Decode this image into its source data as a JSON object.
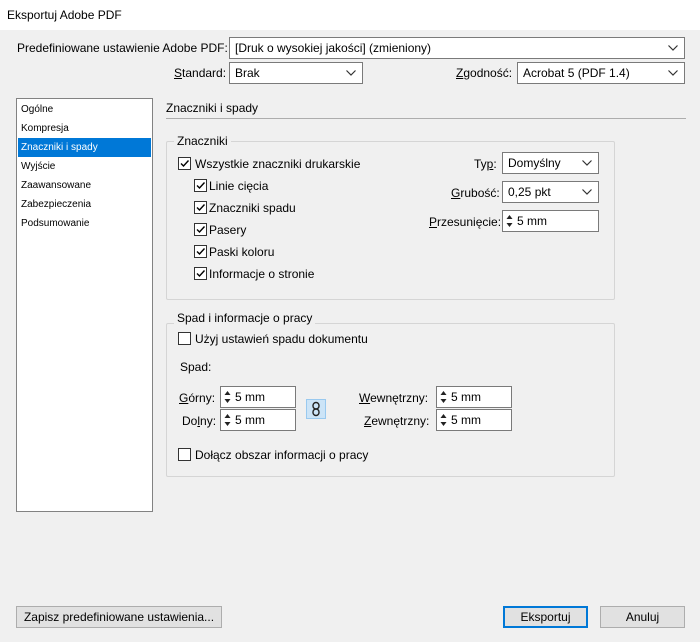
{
  "window": {
    "title": "Eksportuj Adobe PDF"
  },
  "top": {
    "preset_label": "Predefiniowane ustawienie Adobe PDF:",
    "preset_value": "[Druk o wysokiej jakości] (zmieniony)",
    "standard_label": "Standard:",
    "standard_value": "Brak",
    "compat_label": "Zgodność:",
    "compat_value": "Acrobat 5 (PDF 1.4)"
  },
  "sidebar": {
    "items": [
      {
        "label": "Ogólne"
      },
      {
        "label": "Kompresja"
      },
      {
        "label": "Znaczniki i spady"
      },
      {
        "label": "Wyjście"
      },
      {
        "label": "Zaawansowane"
      },
      {
        "label": "Zabezpieczenia"
      },
      {
        "label": "Podsumowanie"
      }
    ],
    "selected": "Znaczniki i spady"
  },
  "panel": {
    "title": "Znaczniki i spady",
    "marks": {
      "group_title": "Znaczniki",
      "all_marks": {
        "label": "Wszystkie znaczniki drukarskie",
        "checked": true
      },
      "items": [
        {
          "label": "Linie cięcia",
          "checked": true
        },
        {
          "label": "Znaczniki spadu",
          "checked": true
        },
        {
          "label": "Pasery",
          "checked": true
        },
        {
          "label": "Paski koloru",
          "checked": true
        },
        {
          "label": "Informacje o stronie",
          "checked": true
        }
      ],
      "type_label": "Typ:",
      "type_value": "Domyślny",
      "weight_label": "Grubość:",
      "weight_value": "0,25 pkt",
      "offset_label": "Przesunięcie:",
      "offset_value": "5 mm"
    },
    "bleed": {
      "group_title": "Spad i informacje o pracy",
      "use_doc": {
        "label": "Użyj ustawień spadu dokumentu",
        "checked": false
      },
      "bleed_label": "Spad:",
      "top_label": "Górny:",
      "top_value": "5 mm",
      "bottom_label": "Dolny:",
      "bottom_value": "5 mm",
      "inside_label": "Wewnętrzny:",
      "inside_value": "5 mm",
      "outside_label": "Zewnętrzny:",
      "outside_value": "5 mm",
      "include_slug": {
        "label": "Dołącz obszar informacji o pracy",
        "checked": false
      }
    }
  },
  "buttons": {
    "save_preset": "Zapisz predefiniowane ustawienia...",
    "export": "Eksportuj",
    "cancel": "Anuluj"
  },
  "colors": {
    "selection": "#0078d7",
    "dialog_bg": "#f0f0f0"
  }
}
